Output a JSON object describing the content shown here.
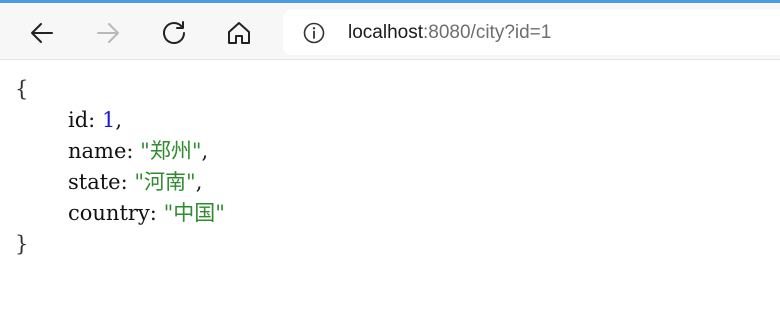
{
  "toolbar": {
    "url_host": "localhost",
    "url_rest": ":8080/city?id=1"
  },
  "json_view": {
    "open_brace": "{",
    "close_brace": "}",
    "fields": [
      {
        "key": "id",
        "value": "1",
        "type": "number",
        "trailing": ","
      },
      {
        "key": "name",
        "value": "\"郑州\"",
        "type": "string",
        "trailing": ","
      },
      {
        "key": "state",
        "value": "\"河南\"",
        "type": "string",
        "trailing": ","
      },
      {
        "key": "country",
        "value": "\"中国\"",
        "type": "string",
        "trailing": ""
      }
    ]
  },
  "colors": {
    "accent": "#4a9be0",
    "number": "#1a1ad6",
    "string": "#2e8b2e"
  },
  "icons": [
    "back-icon",
    "forward-icon",
    "refresh-icon",
    "home-icon",
    "info-icon"
  ]
}
